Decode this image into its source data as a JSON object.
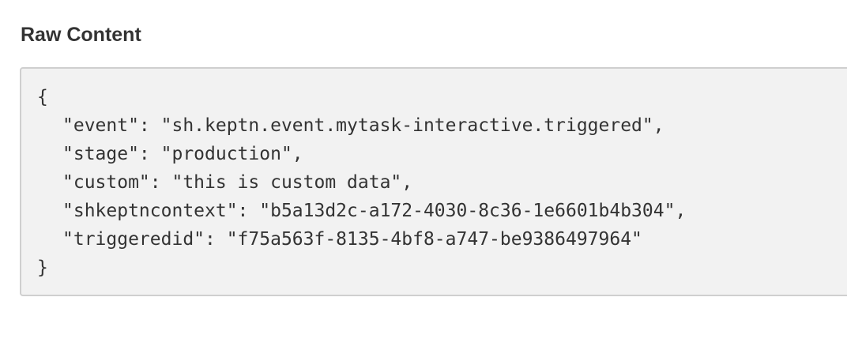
{
  "section": {
    "title": "Raw Content"
  },
  "raw_content": {
    "lines": [
      "{",
      "\"event\": \"sh.keptn.event.mytask-interactive.triggered\",",
      "\"stage\": \"production\",",
      "\"custom\": \"this is custom data\",",
      "\"shkeptncontext\": \"b5a13d2c-a172-4030-8c36-1e6601b4b304\",",
      "\"triggeredid\": \"f75a563f-8135-4bf8-a747-be9386497964\"",
      "}"
    ]
  }
}
